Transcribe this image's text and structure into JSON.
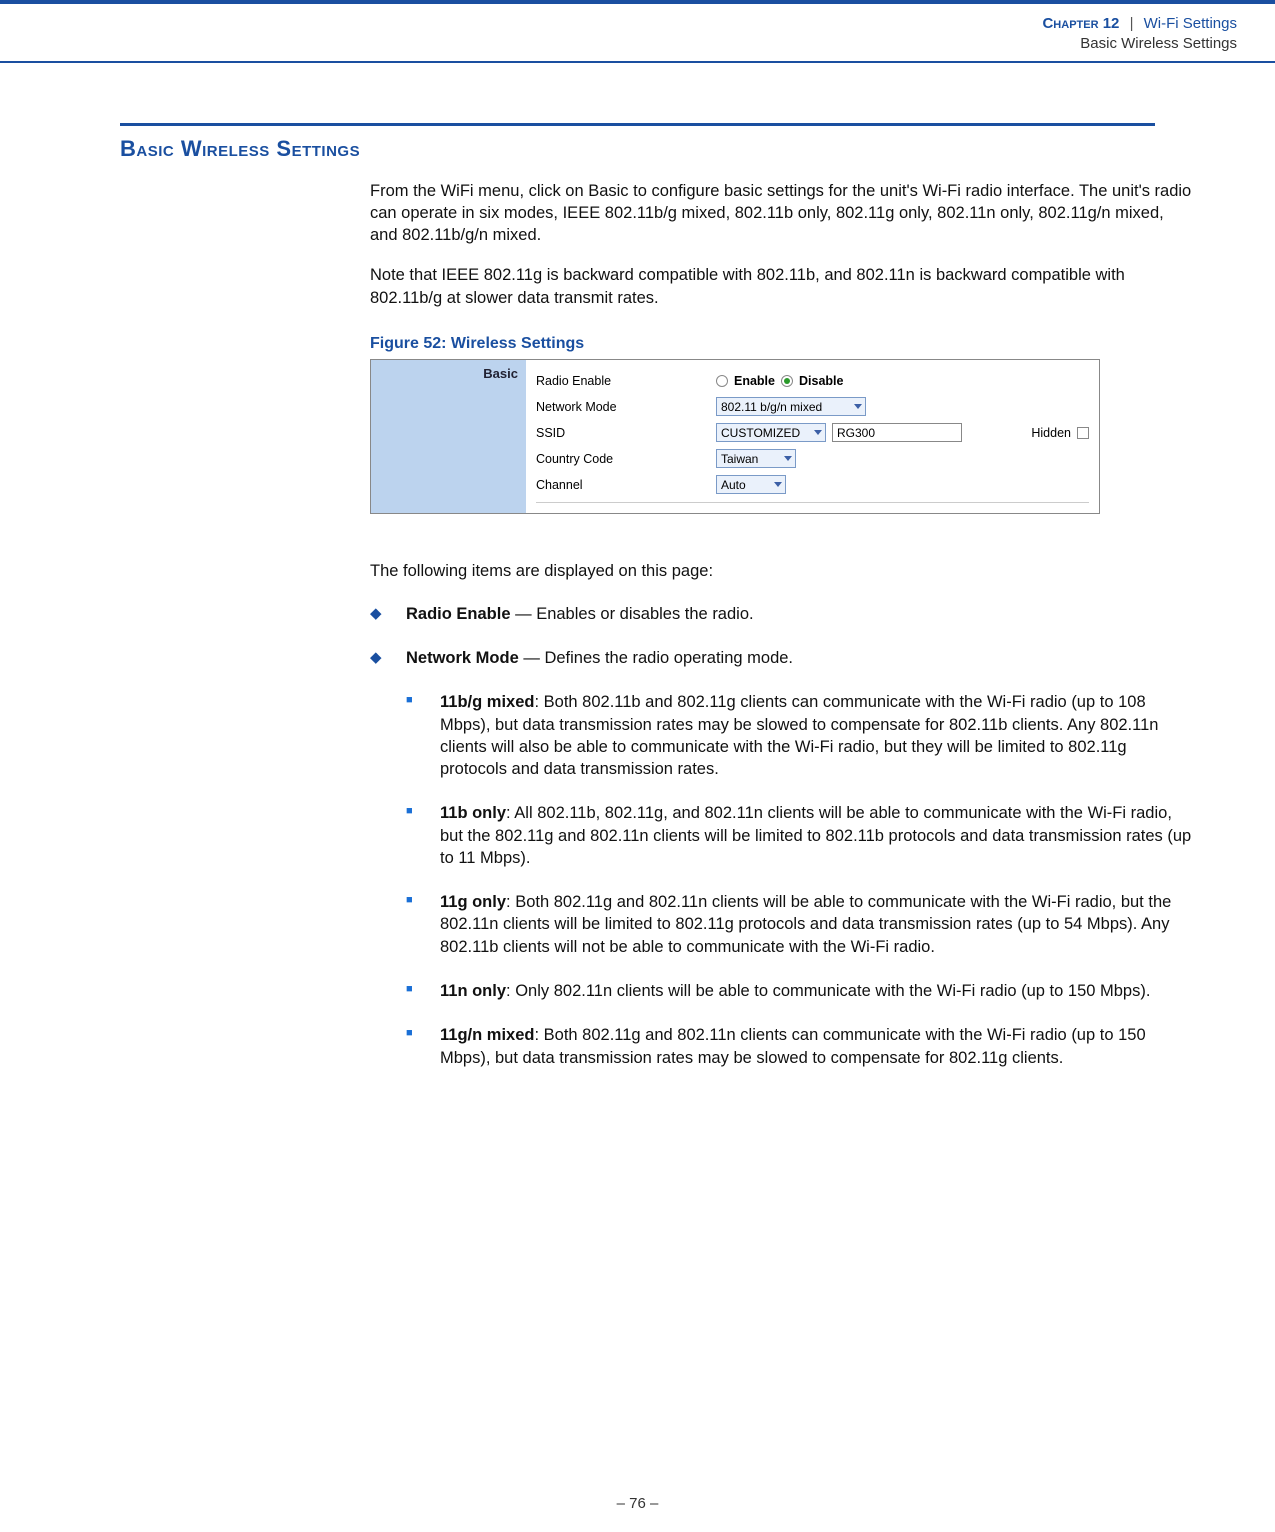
{
  "header": {
    "chapter_label": "Chapter 12",
    "separator": "|",
    "chapter_title": "Wi-Fi Settings",
    "subtitle": "Basic Wireless Settings"
  },
  "section_heading": "Basic Wireless Settings",
  "paragraphs": {
    "p1": "From the WiFi menu, click on Basic to configure basic settings for the unit's Wi-Fi radio interface. The unit's radio can operate in six modes, IEEE 802.11b/g mixed, 802.11b only, 802.11g only, 802.11n only, 802.11g/n mixed, and 802.11b/g/n mixed.",
    "p2": "Note that IEEE 802.11g is backward compatible with 802.11b, and 802.11n is backward compatible with 802.11b/g at slower data transmit rates."
  },
  "figure": {
    "caption": "Figure 52:  Wireless Settings",
    "side_label": "Basic",
    "rows": {
      "radio_enable": {
        "label": "Radio Enable",
        "opt1": "Enable",
        "opt2": "Disable"
      },
      "network_mode": {
        "label": "Network Mode",
        "value": "802.11 b/g/n mixed"
      },
      "ssid": {
        "label": "SSID",
        "sel": "CUSTOMIZED",
        "input": "RG300",
        "hidden_lbl": "Hidden"
      },
      "country": {
        "label": "Country Code",
        "value": "Taiwan"
      },
      "channel": {
        "label": "Channel",
        "value": "Auto"
      }
    }
  },
  "list_intro": "The following items are displayed on this page:",
  "items": {
    "radio_enable": {
      "title": "Radio Enable",
      "dash": " — ",
      "desc": "Enables or disables the radio."
    },
    "network_mode": {
      "title": "Network Mode",
      "dash": " — ",
      "desc": "Defines the radio operating mode."
    }
  },
  "modes": {
    "m1": {
      "title": "11b/g mixed",
      "desc": ": Both 802.11b and 802.11g clients can communicate with the Wi-Fi radio (up to 108 Mbps), but data transmission rates may be slowed to compensate for 802.11b clients. Any 802.11n clients will also be able to communicate with the Wi-Fi radio, but they will be limited to 802.11g protocols and data transmission rates."
    },
    "m2": {
      "title": "11b only",
      "desc": ": All 802.11b, 802.11g, and 802.11n clients will be able to communicate with the Wi-Fi radio, but the 802.11g and 802.11n clients will be limited to 802.11b protocols and data transmission rates (up to 11 Mbps)."
    },
    "m3": {
      "title": "11g only",
      "desc": ": Both 802.11g and 802.11n clients will be able to communicate with the Wi-Fi radio, but the 802.11n clients will be limited to 802.11g protocols and data transmission rates (up to 54 Mbps). Any 802.11b clients will not be able to communicate with the Wi-Fi radio."
    },
    "m4": {
      "title": "11n only",
      "desc": ": Only 802.11n clients will be able to communicate with the Wi-Fi radio (up to 150 Mbps)."
    },
    "m5": {
      "title": "11g/n mixed",
      "desc": ": Both 802.11g and 802.11n clients can communicate with the Wi-Fi radio (up to 150 Mbps), but data transmission rates may be slowed to compensate for 802.11g clients."
    }
  },
  "footer": {
    "page": "–  76  –"
  }
}
